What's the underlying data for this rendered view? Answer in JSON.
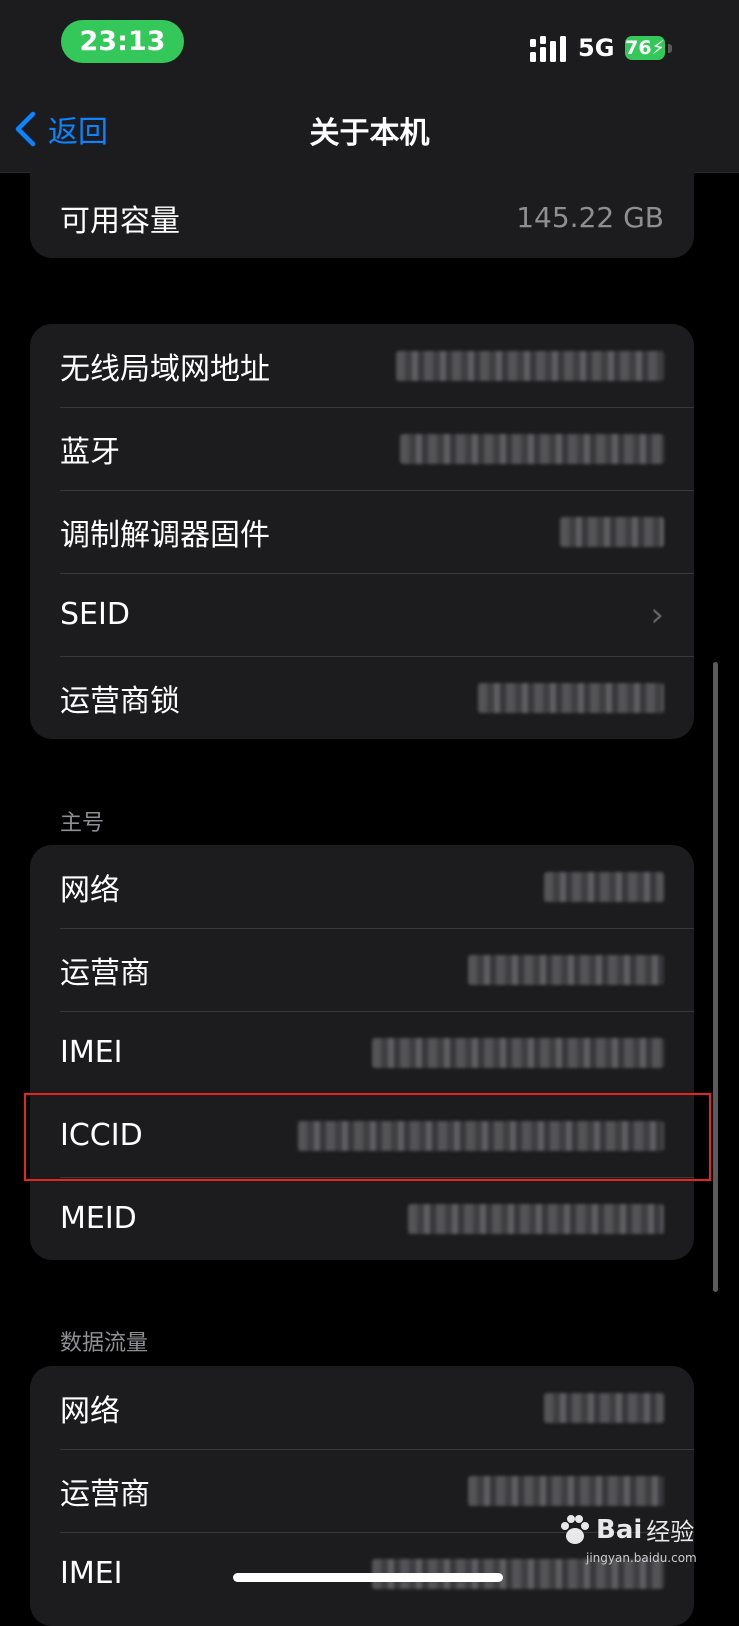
{
  "status_bar": {
    "time": "23:13",
    "network": "5G",
    "battery": "76"
  },
  "nav": {
    "back_label": "返回",
    "title": "关于本机"
  },
  "top_group": {
    "rows": [
      {
        "label": "可用容量",
        "value": "145.22 GB"
      }
    ]
  },
  "group1": {
    "rows": [
      {
        "label": "无线局域网地址"
      },
      {
        "label": "蓝牙"
      },
      {
        "label": "调制解调器固件"
      },
      {
        "label": "SEID"
      },
      {
        "label": "运营商锁"
      }
    ]
  },
  "primary_section": {
    "header": "主号",
    "rows": [
      {
        "label": "网络"
      },
      {
        "label": "运营商"
      },
      {
        "label": "IMEI"
      },
      {
        "label": "ICCID"
      },
      {
        "label": "MEID"
      }
    ]
  },
  "data_section": {
    "header": "数据流量",
    "rows": [
      {
        "label": "网络"
      },
      {
        "label": "运营商"
      },
      {
        "label": "IMEI"
      }
    ]
  },
  "watermark": {
    "brand": "Bai",
    "brand2": "经验",
    "url": "jingyan.baidu.com"
  },
  "colors": {
    "accent": "#0a84ff",
    "highlight": "#e5261e",
    "status_green": "#34c759",
    "cell_bg": "#1c1c1e"
  }
}
